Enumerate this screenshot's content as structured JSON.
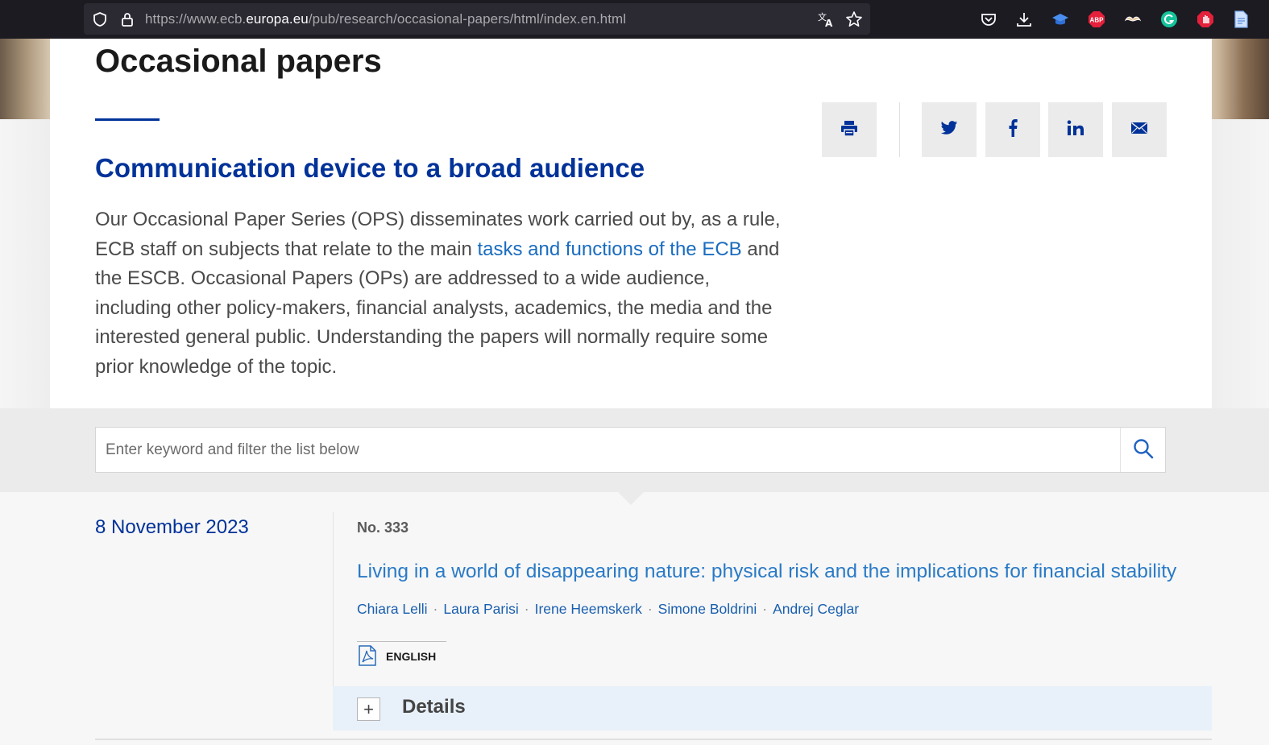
{
  "browser": {
    "url_prefix": "https://www.ecb.",
    "url_domain": "europa.eu",
    "url_path": "/pub/research/occasional-papers/html/index.en.html",
    "ext_abp": "ABP"
  },
  "page": {
    "title": "Occasional papers",
    "subheading": "Communication device to a broad audience",
    "intro_part1": "Our Occasional Paper Series (OPS) disseminates work carried out by, as a rule, ECB staff on subjects that relate to the main ",
    "intro_link": "tasks and functions of the ECB",
    "intro_part2": " and the ESCB. Occasional Papers (OPs) are addressed to a wide audience, including other policy-makers, financial analysts, academics, the media and the interested general public. Understanding the papers will normally require some prior knowledge of the topic."
  },
  "share": [
    "print-icon",
    "twitter-icon",
    "facebook-icon",
    "linkedin-icon",
    "email-icon"
  ],
  "search": {
    "placeholder": "Enter keyword and filter the list below"
  },
  "publications": [
    {
      "date": "8 November 2023",
      "number": "No. 333",
      "title": "Living in a world of disappearing nature: physical risk and the implications for financial stability",
      "authors": [
        "Chiara Lelli",
        "Laura Parisi",
        "Irene Heemskerk",
        "Simone Boldrini",
        "Andrej Ceglar"
      ],
      "language": "ENGLISH",
      "details_label": "Details",
      "expand_symbol": "+"
    }
  ],
  "colors": {
    "brand_blue": "#003299",
    "link_blue": "#2a7ac6"
  }
}
